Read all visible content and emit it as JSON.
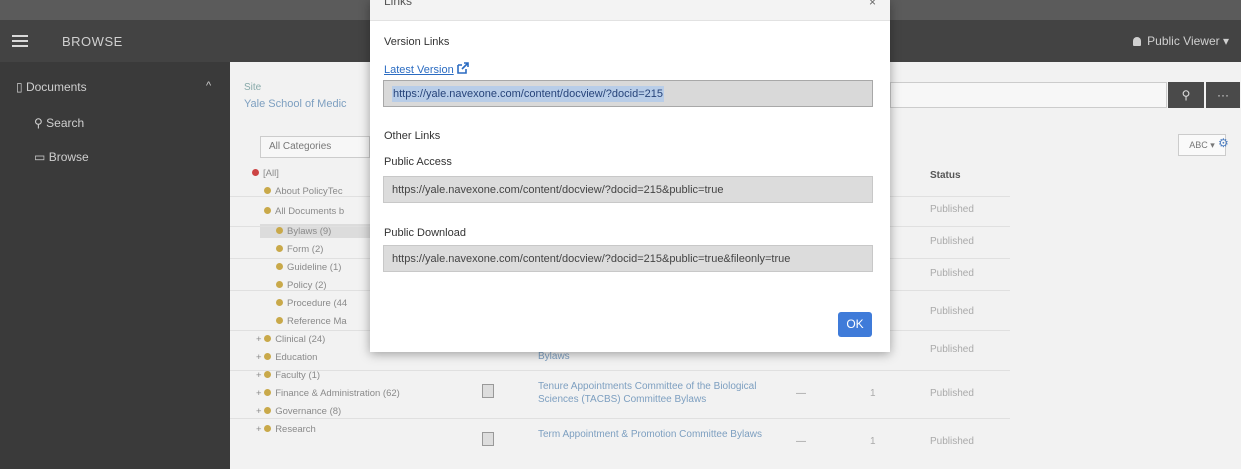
{
  "header": {
    "browse_title": "BROWSE",
    "user": "Public Viewer"
  },
  "sidebar": {
    "documents": "Documents",
    "items": [
      {
        "label": "Search"
      },
      {
        "label": "Browse"
      }
    ]
  },
  "content": {
    "site_label": "Site",
    "site_name": "Yale School of Medic",
    "categories_select": "All Categories",
    "tree": [
      {
        "label": "[All]"
      },
      {
        "label": "About PolicyTec"
      },
      {
        "label": "All Documents b"
      },
      {
        "label": "Bylaws (9)"
      },
      {
        "label": "Form (2)"
      },
      {
        "label": "Guideline (1)"
      },
      {
        "label": "Policy (2)"
      },
      {
        "label": "Procedure (44"
      },
      {
        "label": "Reference Ma"
      },
      {
        "label": "Clinical (24)"
      },
      {
        "label": "Education"
      },
      {
        "label": "Faculty (1)"
      },
      {
        "label": "Finance & Administration (62)"
      },
      {
        "label": "Governance (8)"
      },
      {
        "label": "Research"
      }
    ],
    "sort_label": "ABC",
    "status_header": "Status",
    "rows": [
      {
        "title": "",
        "status": "Published"
      },
      {
        "title": "",
        "status": "Published"
      },
      {
        "title": "",
        "status": "Published"
      },
      {
        "title": "",
        "status": "Published"
      },
      {
        "title": "Bylaws",
        "status": "Published"
      },
      {
        "title": "Tenure Appointments Committee of the Biological Sciences (TACBS) Committee Bylaws",
        "dash": "—",
        "count": "1",
        "status": "Published"
      },
      {
        "title": "Term Appointment & Promotion Committee Bylaws",
        "dash": "—",
        "count": "1",
        "status": "Published"
      }
    ]
  },
  "modal": {
    "title": "Links",
    "close": "×",
    "version_links": "Version Links",
    "latest_version": "Latest Version",
    "latest_url": "https://yale.navexone.com/content/docview/?docid=215",
    "other_links": "Other Links",
    "public_access_label": "Public Access",
    "public_access_url": "https://yale.navexone.com/content/docview/?docid=215&public=true",
    "public_download_label": "Public Download",
    "public_download_url": "https://yale.navexone.com/content/docview/?docid=215&public=true&fileonly=true",
    "ok": "OK"
  },
  "colors": {
    "accent": "#3f7bd9",
    "link": "#2b6cc2",
    "header_bg": "#434343",
    "sidebar_bg": "#3a3a3a"
  }
}
